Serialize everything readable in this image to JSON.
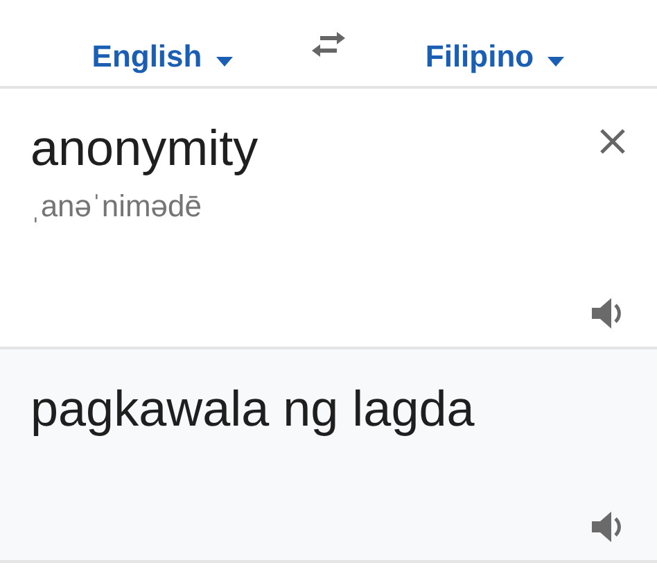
{
  "languages": {
    "source": "English",
    "target": "Filipino"
  },
  "input": {
    "text": "anonymity",
    "pronunciation": "ˌanəˈnimədē"
  },
  "output": {
    "text": "pagkawala ng lagda"
  }
}
